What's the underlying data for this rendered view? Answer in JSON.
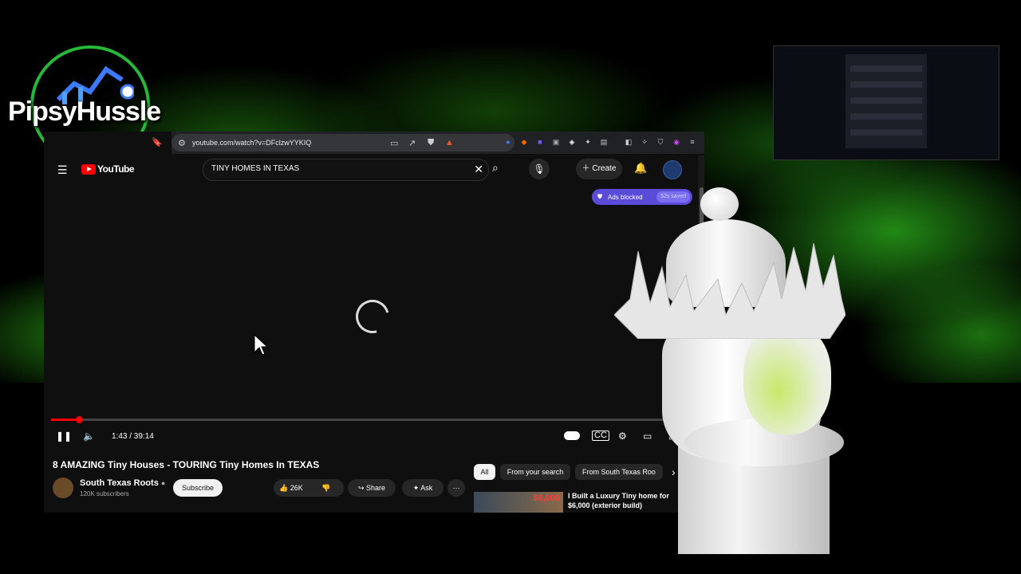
{
  "logo": {
    "text": "PipsyHussle"
  },
  "browser": {
    "url": "youtube.com/watch?v=DFclzwYYKIQ"
  },
  "youtube": {
    "logo_text": "YouTube",
    "search_query": "TINY HOMES IN TEXAS",
    "create_label": "Create",
    "ads_blocked_label": "Ads blocked",
    "ads_saved_label": "52s saved",
    "player": {
      "time": "1:43 / 39:14",
      "progress": 0.044
    },
    "video": {
      "title": "8 AMAZING Tiny Houses - TOURING Tiny Homes In TEXAS",
      "channel": "South Texas Roots",
      "subscribers": "120K subscribers",
      "subscribe_label": "Subscribe",
      "likes": "26K",
      "share_label": "Share",
      "ask_label": "Ask"
    },
    "chips": [
      "All",
      "From your search",
      "From South Texas Roo"
    ],
    "recommendation": {
      "title": "I Built a Luxury Tiny home for $6,000 (exterior build)",
      "thumb_text": "$6,000"
    }
  },
  "colors": {
    "accent_red": "#ff0000",
    "adblock_purple": "#5a4cd8",
    "smoke_green": "#2a9c1a"
  }
}
